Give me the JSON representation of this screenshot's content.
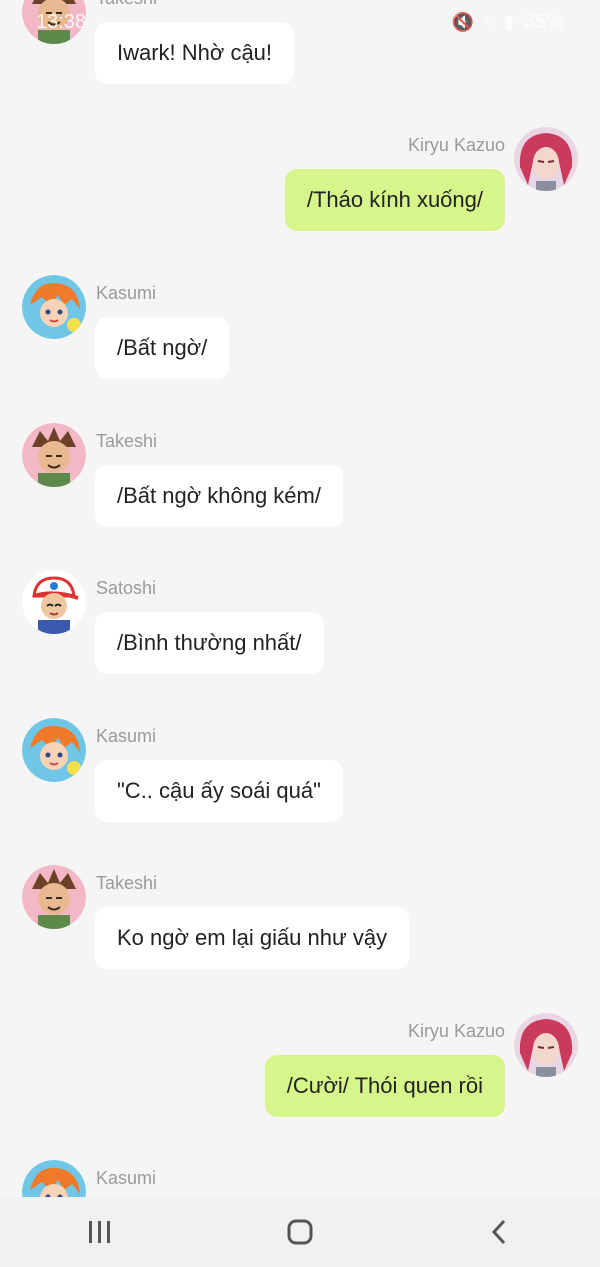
{
  "status_bar": {
    "time": "13:38",
    "battery": "35%"
  },
  "messages": [
    {
      "sender": "Takeshi",
      "text": "Iwark! Nhờ cậu!",
      "side": "left",
      "avatar": "takeshi"
    },
    {
      "sender": "Kiryu Kazuo",
      "text": "/Tháo kính xuống/",
      "side": "right",
      "avatar": "kiryu"
    },
    {
      "sender": "Kasumi",
      "text": "/Bất ngờ/",
      "side": "left",
      "avatar": "kasumi"
    },
    {
      "sender": "Takeshi",
      "text": "/Bất ngờ không kém/",
      "side": "left",
      "avatar": "takeshi"
    },
    {
      "sender": "Satoshi",
      "text": "/Bình thường nhất/",
      "side": "left",
      "avatar": "satoshi"
    },
    {
      "sender": "Kasumi",
      "text": "\"C.. cậu ấy soái quá\"",
      "side": "left",
      "avatar": "kasumi"
    },
    {
      "sender": "Takeshi",
      "text": "Ko ngờ em lại giấu như vậy",
      "side": "left",
      "avatar": "takeshi"
    },
    {
      "sender": "Kiryu Kazuo",
      "text": "/Cười/ Thói quen rồi",
      "side": "right",
      "avatar": "kiryu"
    },
    {
      "sender": "Kasumi",
      "text": "",
      "side": "left",
      "avatar": "kasumi"
    }
  ],
  "nav": {
    "recents_icon": "recents-icon",
    "home_icon": "home-icon",
    "back_icon": "back-icon"
  },
  "colors": {
    "outgoing_bubble": "#d6f58a",
    "incoming_bubble": "#ffffff",
    "background": "#f5f5f5"
  }
}
